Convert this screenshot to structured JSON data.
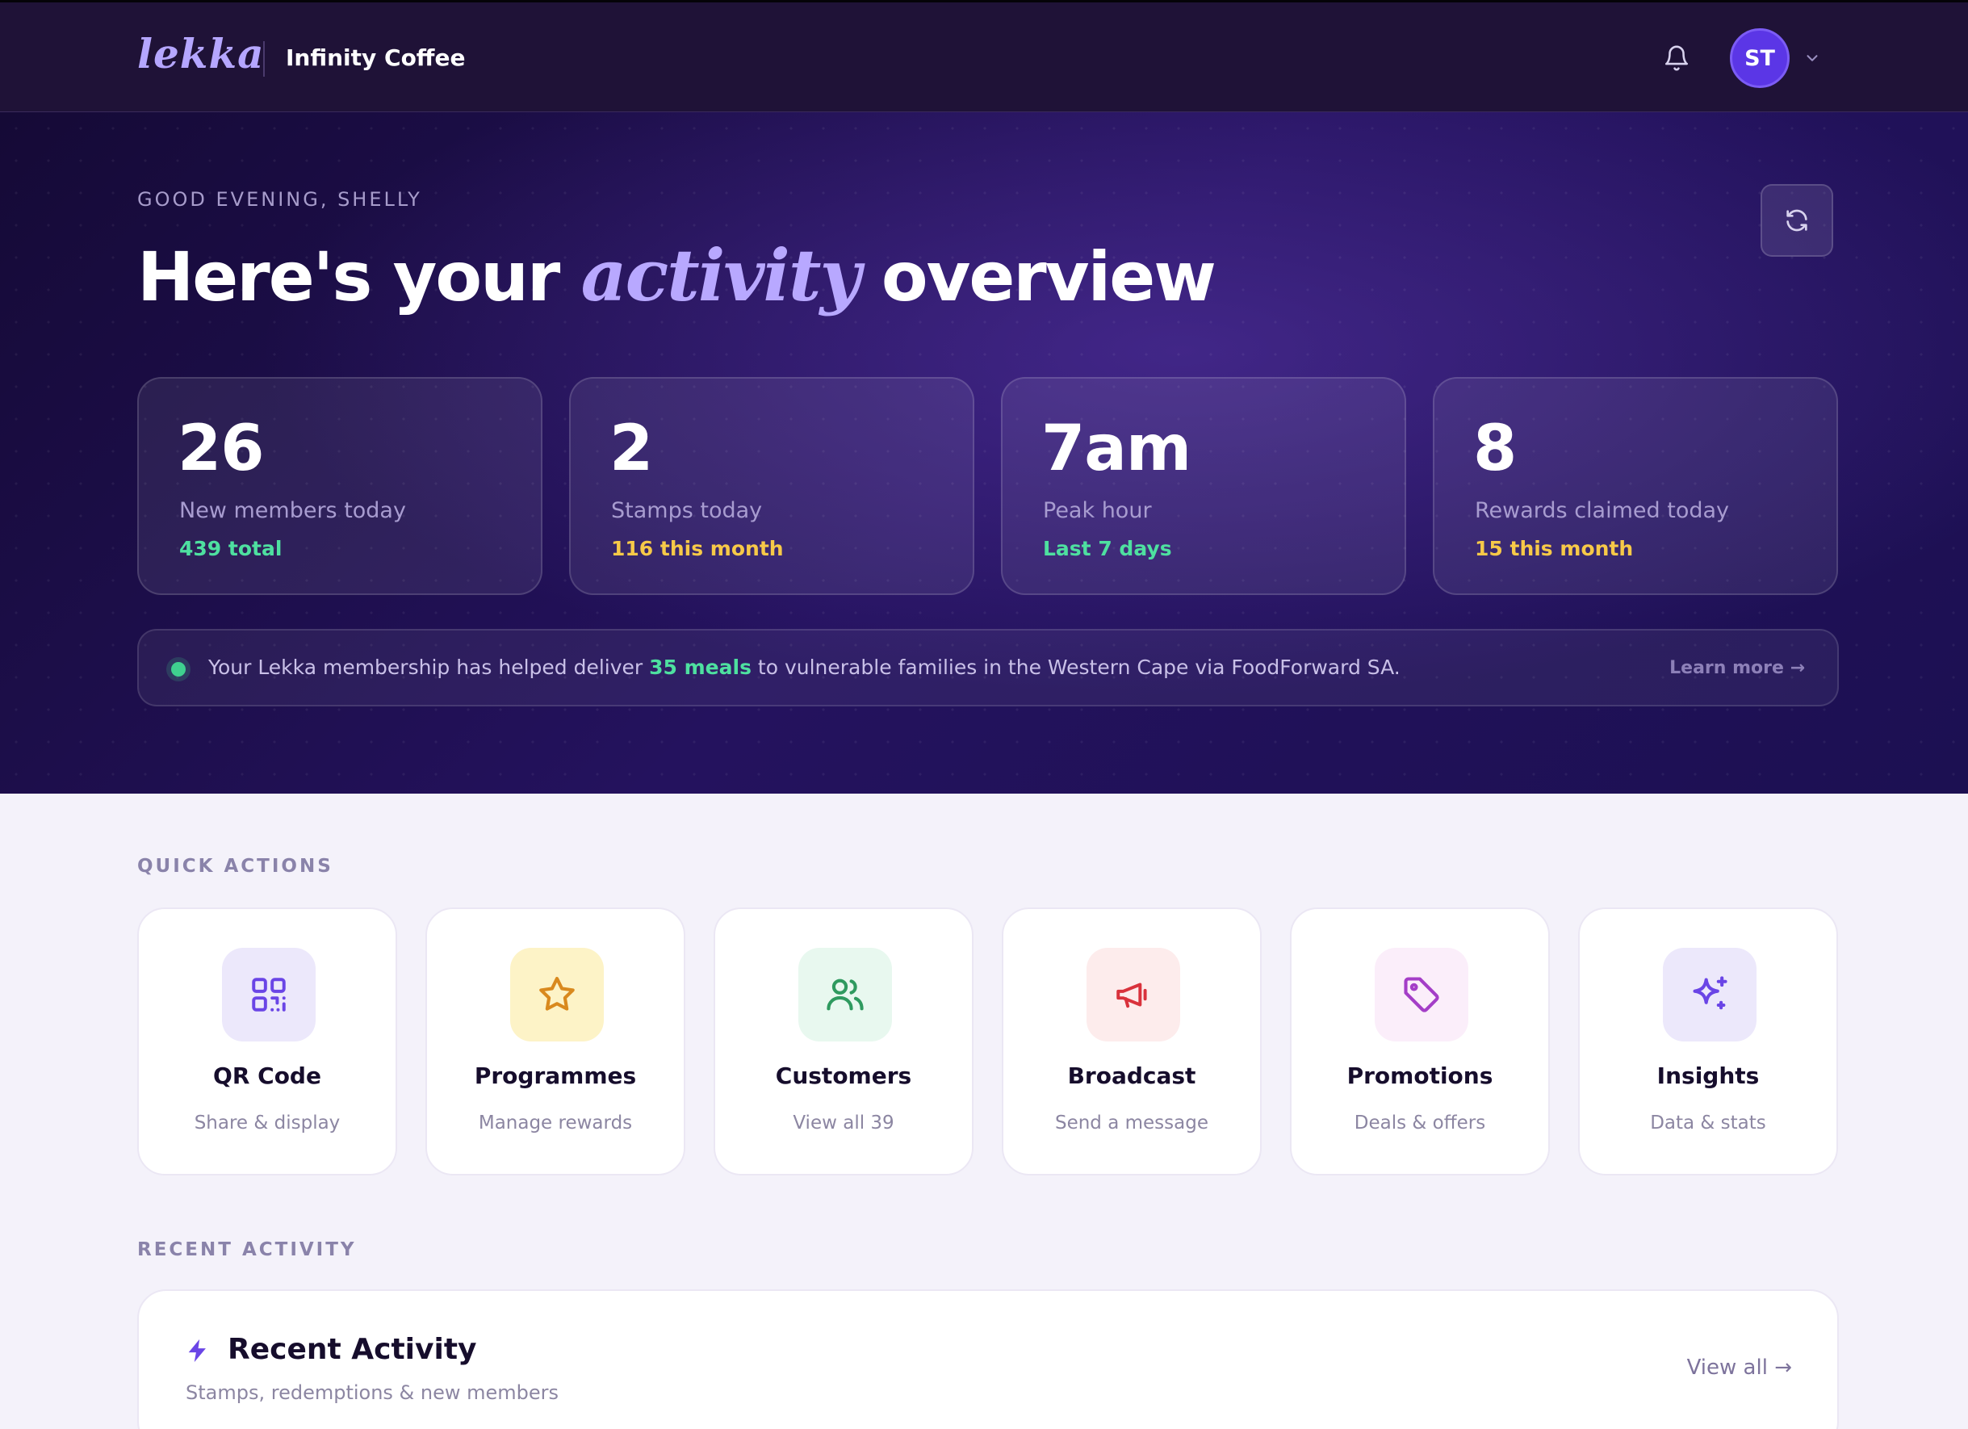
{
  "header": {
    "logo": "lekka",
    "shop_name": "Infinity Coffee",
    "avatar_initials": "ST"
  },
  "hero": {
    "greeting": "GOOD EVENING, SHELLY",
    "headline_pre": "Here's your",
    "headline_accent": "activity",
    "headline_post": "overview",
    "stats": [
      {
        "value": "26",
        "label": "New members today",
        "sub": "439 total",
        "sub_color": "#4ee0a0"
      },
      {
        "value": "2",
        "label": "Stamps today",
        "sub": "116 this month",
        "sub_color": "#f7c948"
      },
      {
        "value": "7am",
        "label": "Peak hour",
        "sub": "Last 7 days",
        "sub_color": "#4ee0a0"
      },
      {
        "value": "8",
        "label": "Rewards claimed today",
        "sub": "15 this month",
        "sub_color": "#f7c948"
      }
    ],
    "impact": {
      "text_pre": "Your Lekka membership has helped deliver",
      "highlight": "35 meals",
      "text_post": "to vulnerable families in the Western Cape via FoodForward SA.",
      "link": "Learn more →"
    }
  },
  "quick_actions": {
    "label": "QUICK ACTIONS",
    "items": [
      {
        "title": "QR Code",
        "sub": "Share & display",
        "icon": "qr-code-icon",
        "bg": "#ece8fb",
        "fg": "#6a45e6"
      },
      {
        "title": "Programmes",
        "sub": "Manage rewards",
        "icon": "star-icon",
        "bg": "#fdf3c7",
        "fg": "#d9891e"
      },
      {
        "title": "Customers",
        "sub": "View all 39",
        "icon": "users-icon",
        "bg": "#e8f8ef",
        "fg": "#2f9a5f"
      },
      {
        "title": "Broadcast",
        "sub": "Send a message",
        "icon": "megaphone-icon",
        "bg": "#fdecec",
        "fg": "#d9323c"
      },
      {
        "title": "Promotions",
        "sub": "Deals & offers",
        "icon": "tag-icon",
        "bg": "#fbeefa",
        "fg": "#a43ec7"
      },
      {
        "title": "Insights",
        "sub": "Data & stats",
        "icon": "sparkle-icon",
        "bg": "#ece8fb",
        "fg": "#6a45e6"
      }
    ]
  },
  "recent_activity": {
    "label": "RECENT ACTIVITY",
    "title": "Recent Activity",
    "sub": "Stamps, redemptions & new members",
    "view_all": "View all →"
  }
}
